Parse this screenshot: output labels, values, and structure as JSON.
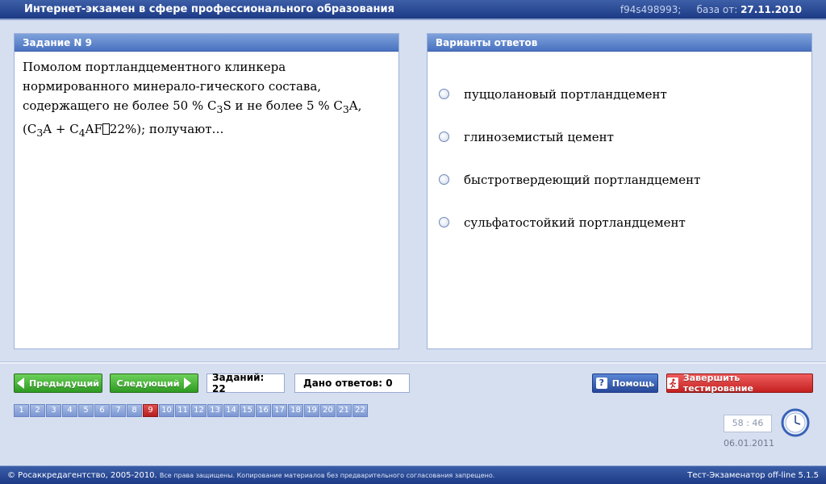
{
  "titlebar": {
    "title": "Интернет-экзамен в сфере профессионального образования",
    "session_id": "f94s498993;",
    "base_label": "база от:",
    "base_date": "27.11.2010"
  },
  "task": {
    "header": "Задание N 9",
    "line1": "Помолом портландцементного клинкера",
    "line2": "нормированного минерало-гического состава,",
    "line3_pre": "содержащего не более 50 % C",
    "line3_sub1": "3",
    "line3_mid": "S и не более 5 % C",
    "line3_sub2": "3",
    "line3_post": "A,",
    "line4_a": "(C",
    "line4_sub1": "3",
    "line4_b": "A + C",
    "line4_sub2": "4",
    "line4_c": "AF",
    "line4_box": "",
    "line4_d": "22%); получают…"
  },
  "answers": {
    "header": "Варианты ответов",
    "items": [
      "пуццолановый портландцемент",
      "глиноземистый цемент",
      "быстротвердеющий портландцемент",
      "сульфатостойкий портландцемент"
    ]
  },
  "toolbar": {
    "prev_label": "Предыдущий",
    "next_label": "Следующий",
    "tasks_count": "Заданий: 22",
    "answers_count": "Дано ответов: 0",
    "help_label": "Помощь",
    "help_glyph": "?",
    "finish_label": "Завершить тестирование"
  },
  "pager": {
    "pages": [
      "1",
      "2",
      "3",
      "4",
      "5",
      "6",
      "7",
      "8",
      "9",
      "10",
      "11",
      "12",
      "13",
      "14",
      "15",
      "16",
      "17",
      "18",
      "19",
      "20",
      "21",
      "22"
    ],
    "current": "9"
  },
  "timer": {
    "value": "58 : 46",
    "date": "06.01.2011"
  },
  "footer": {
    "copyright": "© Росаккредагентство, 2005-2010.",
    "notice": "Все права защищены. Копирование материалов без предварительного согласования запрещено.",
    "version": "Тест-Экзаменатор off-line 5.1.5"
  },
  "colors": {
    "title_bar": "#1d3a85",
    "panel_header": "#4a72c0",
    "button_green": "#2e9a22",
    "button_blue": "#26479a",
    "button_red": "#c42020",
    "current_page": "#b51e1e"
  }
}
